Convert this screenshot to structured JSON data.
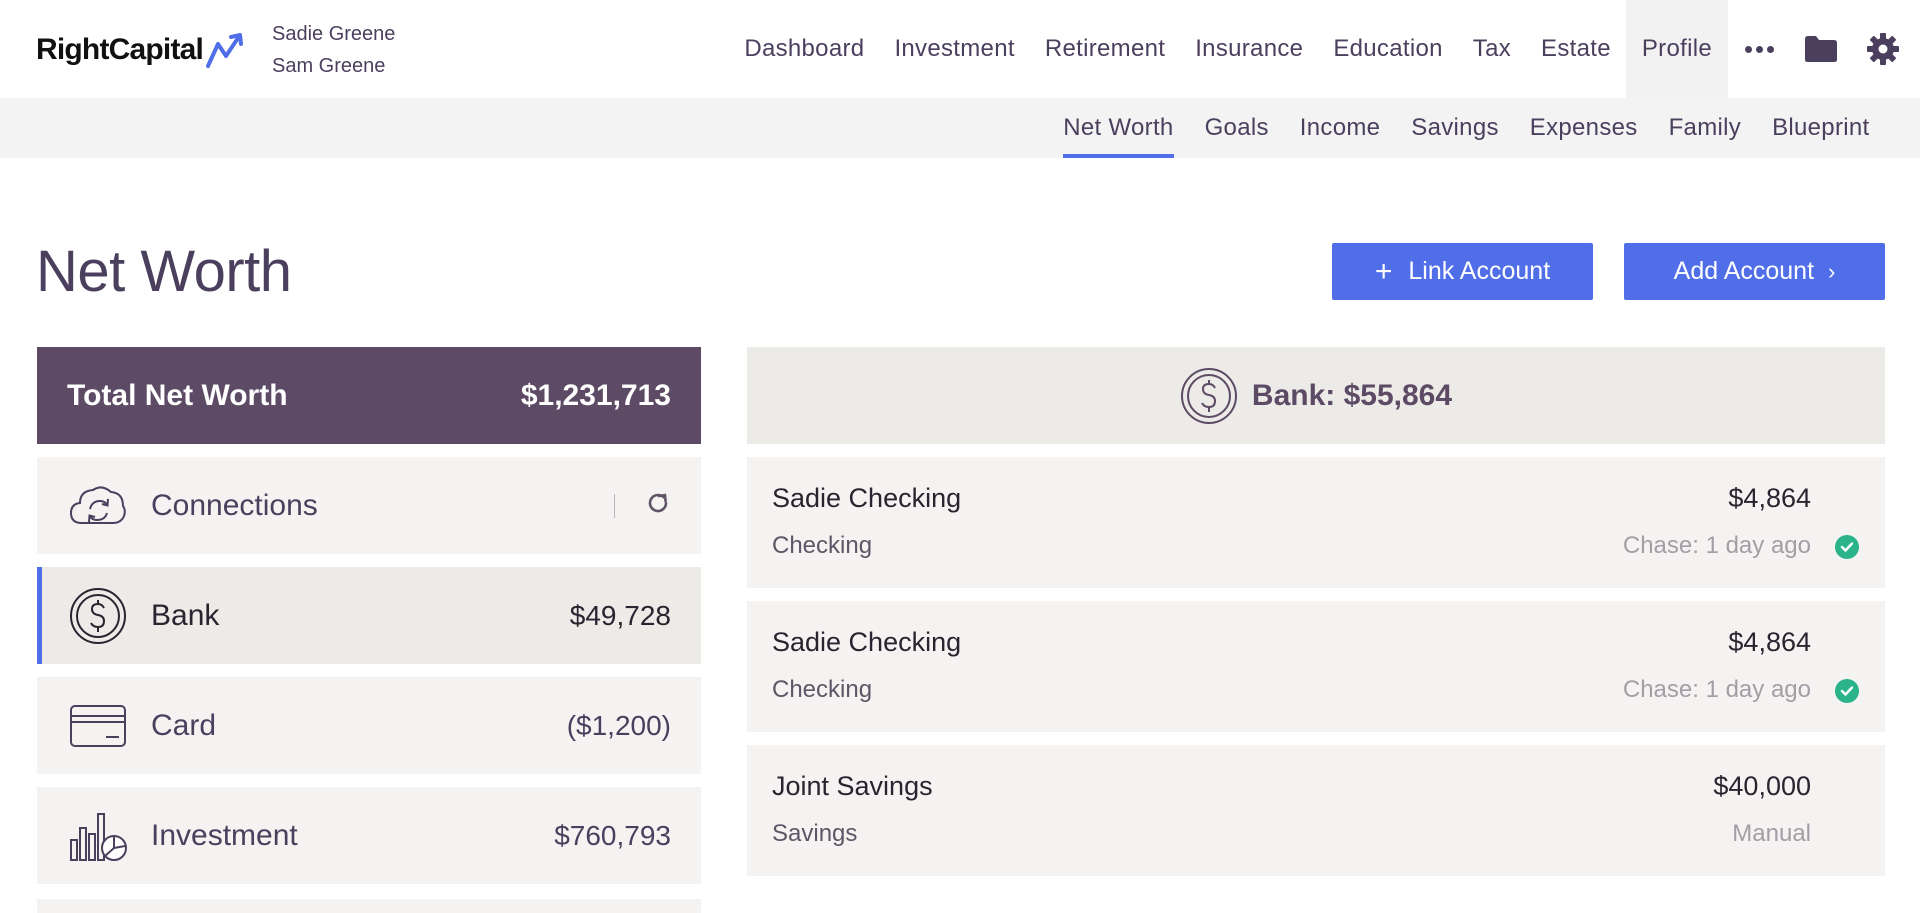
{
  "brand": {
    "name": "RightCapital",
    "clients": [
      "Sadie Greene",
      "Sam Greene"
    ]
  },
  "main_nav": {
    "items": [
      "Dashboard",
      "Investment",
      "Retirement",
      "Insurance",
      "Education",
      "Tax",
      "Estate",
      "Profile"
    ],
    "active": "Profile",
    "icons": [
      "more-icon",
      "folder-icon",
      "gear-icon"
    ]
  },
  "sub_nav": {
    "items": [
      "Net Worth",
      "Goals",
      "Income",
      "Savings",
      "Expenses",
      "Family",
      "Blueprint"
    ],
    "active": "Net Worth"
  },
  "page": {
    "title": "Net Worth",
    "link_account_label": "Link Account",
    "add_account_label": "Add Account"
  },
  "summary": {
    "label": "Total Net Worth",
    "value": "$1,231,713"
  },
  "categories": [
    {
      "label": "Connections",
      "value": "",
      "icon": "cloud-sync-icon"
    },
    {
      "label": "Bank",
      "value": "$49,728",
      "icon": "dollar-coin-icon",
      "selected": true
    },
    {
      "label": "Card",
      "value": "($1,200)",
      "icon": "credit-card-icon"
    },
    {
      "label": "Investment",
      "value": "$760,793",
      "icon": "investment-chart-icon"
    }
  ],
  "detail": {
    "header": "Bank: $55,864",
    "accounts": [
      {
        "name": "Sadie Checking",
        "type": "Checking",
        "amount": "$4,864",
        "status": "Chase: 1 day ago",
        "synced": true
      },
      {
        "name": "Sadie Checking",
        "type": "Checking",
        "amount": "$4,864",
        "status": "Chase: 1 day ago",
        "synced": true
      },
      {
        "name": "Joint Savings",
        "type": "Savings",
        "amount": "$40,000",
        "status": "Manual",
        "synced": false
      }
    ]
  },
  "colors": {
    "accent": "#4f6ee8",
    "brand_purple": "#5d4b66",
    "text": "#4b3f5e",
    "success": "#2bb38a"
  }
}
